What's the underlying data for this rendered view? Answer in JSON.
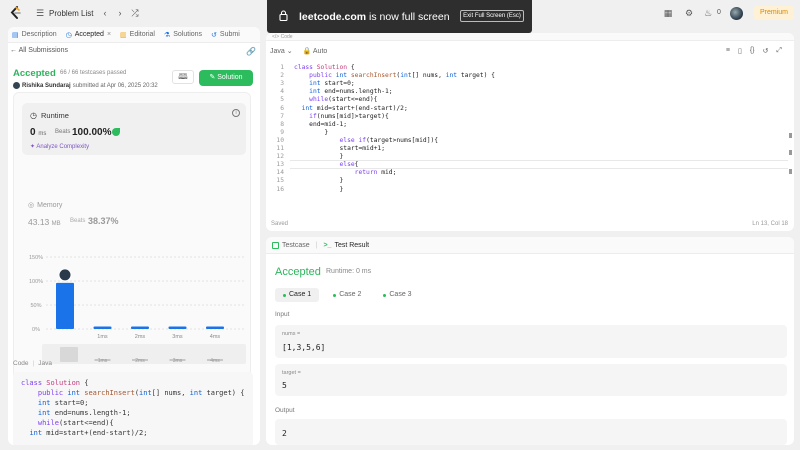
{
  "topbar": {
    "problem_list": "Problem List",
    "fire_count": "0",
    "premium": "Premium"
  },
  "banner": {
    "domain": "leetcode.com",
    "message": " is now full screen",
    "exit_label": "Exit Full Screen (Esc)"
  },
  "left_tabs": [
    {
      "label": "Description",
      "icon": "document-icon"
    },
    {
      "label": "Accepted",
      "icon": "clock-icon",
      "active": true
    },
    {
      "label": "Editorial",
      "icon": "book-icon"
    },
    {
      "label": "Solutions",
      "icon": "flask-icon"
    },
    {
      "label": "Submi",
      "icon": "history-icon"
    }
  ],
  "submission": {
    "back_label": "All Submissions",
    "status": "Accepted",
    "passed": "66 / 66 testcases passed",
    "user": "Rishika Sundaraj",
    "submitted": "submitted at Apr 06, 2025 20:32",
    "solution_btn": "Solution"
  },
  "runtime": {
    "title": "Runtime",
    "value": "0",
    "unit": "ms",
    "beats_label": "Beats",
    "beats": "100.00%",
    "analyze": "Analyze Complexity"
  },
  "memory": {
    "title": "Memory",
    "value": "43.13",
    "unit": "MB",
    "beats_label": "Beats",
    "beats": "38.37%"
  },
  "chart_data": {
    "type": "bar",
    "categories": [
      "0ms",
      "1ms",
      "2ms",
      "3ms",
      "4ms"
    ],
    "values": [
      96,
      4,
      4,
      4,
      4
    ],
    "yticks": [
      "150%",
      "100%",
      "50%",
      "0%"
    ],
    "ylim": [
      0,
      150
    ],
    "grid": true,
    "accent": "#1a73e8"
  },
  "code_header": {
    "tab1": "Code",
    "tab2": "Java"
  },
  "left_code": [
    "class Solution {",
    "    public int searchInsert(int[] nums, int target) {",
    "    int start=0;",
    "    int end=nums.length-1;",
    "    while(start<=end){",
    "  int mid=start+(end-start)/2;"
  ],
  "editor": {
    "top_label": "</> Code",
    "lang": "Java",
    "mode": "Auto",
    "saved": "Saved",
    "position": "Ln 13, Col 18",
    "lines": [
      {
        "n": "1",
        "t": "class Solution {"
      },
      {
        "n": "2",
        "t": "    public int searchInsert(int[] nums, int target) {"
      },
      {
        "n": "3",
        "t": "    int start=0;"
      },
      {
        "n": "4",
        "t": "    int end=nums.length-1;"
      },
      {
        "n": "5",
        "t": "    while(start<=end){"
      },
      {
        "n": "6",
        "t": "  int mid=start+(end-start)/2;"
      },
      {
        "n": "7",
        "t": "    if(nums[mid]>target){"
      },
      {
        "n": "8",
        "t": "    end=mid-1;"
      },
      {
        "n": "9",
        "t": "        }"
      },
      {
        "n": "10",
        "t": "            else if(target>nums[mid]){"
      },
      {
        "n": "11",
        "t": "            start=mid+1;"
      },
      {
        "n": "12",
        "t": "            }"
      },
      {
        "n": "13",
        "t": "            else{"
      },
      {
        "n": "14",
        "t": "                return mid;"
      },
      {
        "n": "15",
        "t": "            }"
      },
      {
        "n": "16",
        "t": "            }"
      }
    ]
  },
  "test": {
    "tab_testcase": "Testcase",
    "tab_result": "Test Result",
    "status": "Accepted",
    "runtime": "Runtime: 0 ms",
    "cases": [
      "Case 1",
      "Case 2",
      "Case 3"
    ],
    "input_label": "Input",
    "nums_label": "nums =",
    "nums_value": "[1,3,5,6]",
    "target_label": "target =",
    "target_value": "5",
    "output_label": "Output",
    "output_value": "2"
  }
}
